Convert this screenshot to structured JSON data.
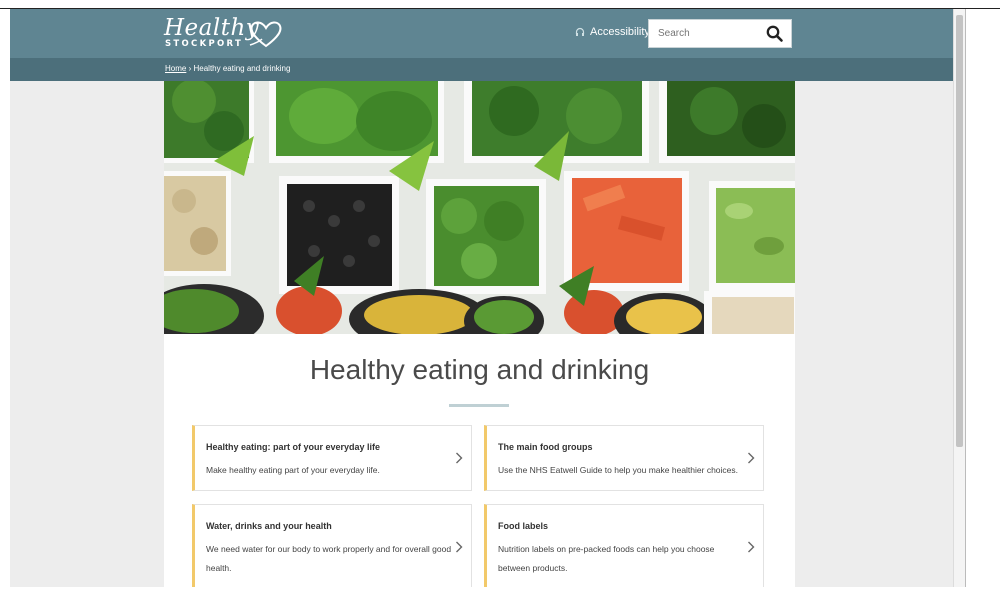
{
  "header": {
    "logo_main": "Healthy",
    "logo_sub": "STOCKPORT",
    "accessibility_label": "Accessibility",
    "search_placeholder": "Search"
  },
  "breadcrumb": {
    "home": "Home",
    "separator": "›",
    "current": "Healthy eating and drinking"
  },
  "page": {
    "title": "Healthy eating and drinking"
  },
  "cards": [
    {
      "title": "Healthy eating: part of your everyday life",
      "description": "Make healthy eating part of your everyday life."
    },
    {
      "title": "The main food groups",
      "description": "Use the NHS Eatwell Guide to help you make healthier choices."
    },
    {
      "title": "Water, drinks and your health",
      "description": "We need water for our body to work properly and for overall good health."
    },
    {
      "title": "Food labels",
      "description": "Nutrition labels on pre-packed foods can help you choose between products."
    }
  ],
  "colors": {
    "header": "#5f8592",
    "breadcrumb_bar": "#4c6f7b",
    "card_accent": "#f2c96a",
    "background": "#ededed"
  }
}
